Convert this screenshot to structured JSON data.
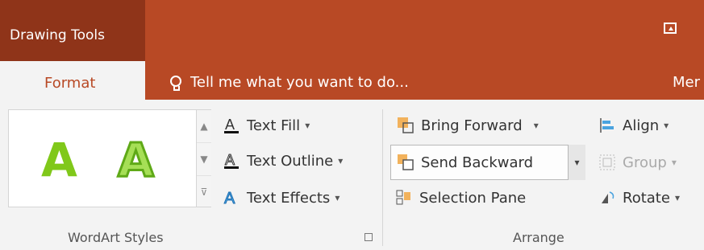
{
  "titlebar": {
    "context_tab": "Drawing Tools"
  },
  "tabs": {
    "active": "Format",
    "more": "Mer"
  },
  "tell_me": {
    "text": "Tell me what you want to do..."
  },
  "wordart": {
    "sample1": "A",
    "sample2": "A",
    "commands": [
      {
        "label": "Text Fill",
        "icon": "text-fill-icon"
      },
      {
        "label": "Text Outline",
        "icon": "text-outline-icon"
      },
      {
        "label": "Text Effects",
        "icon": "text-effects-icon"
      }
    ],
    "group_label": "WordArt Styles"
  },
  "arrange": {
    "bring_forward": "Bring Forward",
    "send_backward": "Send Backward",
    "selection_pane": "Selection Pane",
    "align": "Align",
    "group": "Group",
    "rotate": "Rotate",
    "group_label": "Arrange"
  },
  "colors": {
    "accent": "#b84925",
    "context": "#8f3419",
    "wordart_green": "#80c81a"
  }
}
